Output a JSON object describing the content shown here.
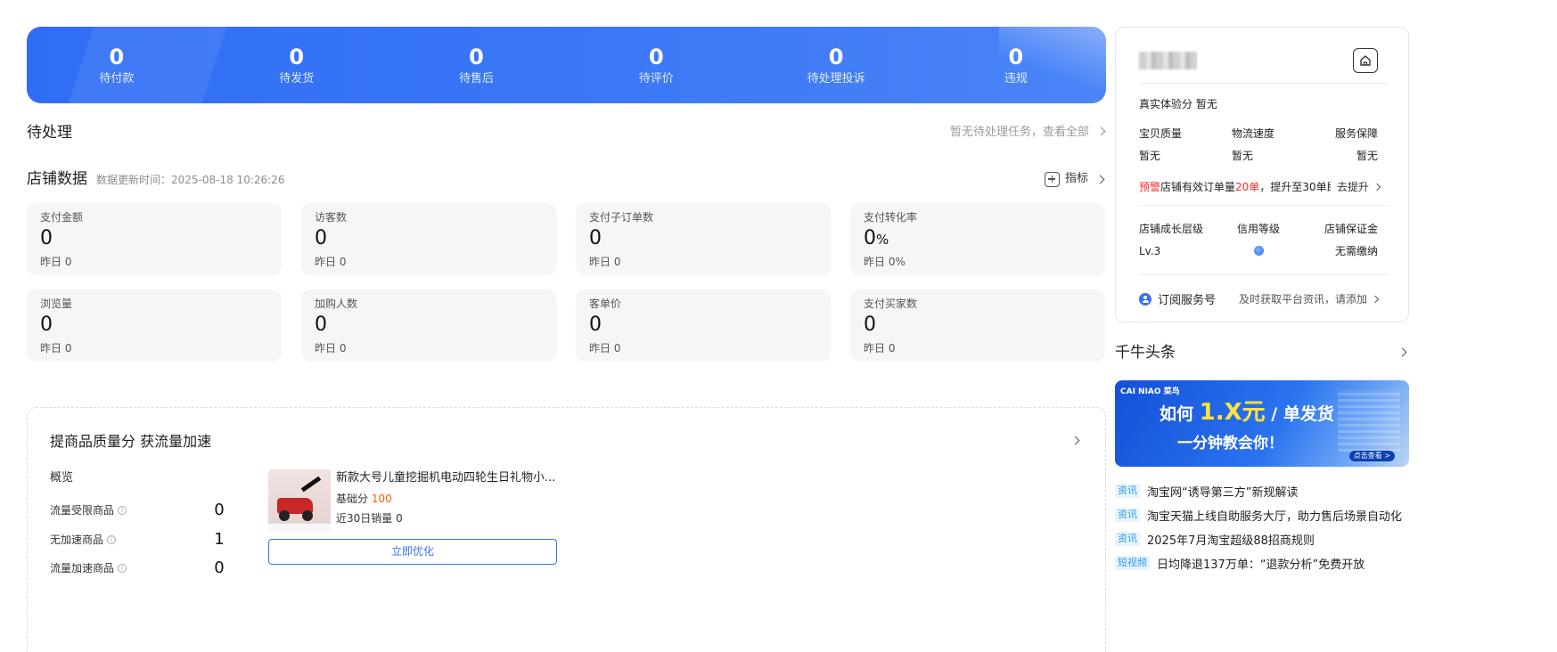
{
  "status_bar": [
    {
      "count": "0",
      "label": "待付款"
    },
    {
      "count": "0",
      "label": "待发货"
    },
    {
      "count": "0",
      "label": "待售后"
    },
    {
      "count": "0",
      "label": "待评价"
    },
    {
      "count": "0",
      "label": "待处理投诉"
    },
    {
      "count": "0",
      "label": "违规"
    }
  ],
  "pending": {
    "title": "待处理",
    "link": "暂无待处理任务，查看全部"
  },
  "store_data": {
    "title": "店铺数据",
    "update_time": "数据更新时间：2025-08-18 10:26:26",
    "metric_button": "指标",
    "cards": [
      {
        "label": "支付金额",
        "value": "0",
        "unit": "",
        "yesterday": "昨日 0"
      },
      {
        "label": "访客数",
        "value": "0",
        "unit": "",
        "yesterday": "昨日 0"
      },
      {
        "label": "支付子订单数",
        "value": "0",
        "unit": "",
        "yesterday": "昨日 0"
      },
      {
        "label": "支付转化率",
        "value": "0",
        "unit": "%",
        "yesterday": "昨日 0%"
      },
      {
        "label": "浏览量",
        "value": "0",
        "unit": "",
        "yesterday": "昨日 0"
      },
      {
        "label": "加购人数",
        "value": "0",
        "unit": "",
        "yesterday": "昨日 0"
      },
      {
        "label": "客单价",
        "value": "0",
        "unit": "",
        "yesterday": "昨日 0"
      },
      {
        "label": "支付买家数",
        "value": "0",
        "unit": "",
        "yesterday": "昨日 0"
      }
    ]
  },
  "quality": {
    "title": "提商品质量分 获流量加速",
    "overview_label": "概览",
    "rows": [
      {
        "label": "流量受限商品",
        "value": "0"
      },
      {
        "label": "无加速商品",
        "value": "1"
      },
      {
        "label": "流量加速商品",
        "value": "0"
      }
    ],
    "product": {
      "name": "新款大号儿童挖掘机电动四轮生日礼物小...",
      "score_label": "基础分",
      "score": "100",
      "sales": "近30日销量 0"
    },
    "optimize_button": "立即优化"
  },
  "shop_card": {
    "experience_score": "真实体验分  暂无",
    "metrics_labels": [
      "宝贝质量",
      "物流速度",
      "服务保障"
    ],
    "metrics_values": [
      "暂无",
      "暂无",
      "暂无"
    ],
    "warning": {
      "tag": "预警",
      "text_before": "店铺有效订单量",
      "highlight": "20单",
      "text_after": "，提升至30单即..."
    },
    "improve_link": "去提升",
    "level_labels": [
      "店铺成长层级",
      "信用等级",
      "店铺保证金"
    ],
    "level_value": "Lv.3",
    "deposit_value": "无需缴纳",
    "subscribe_label": "订阅服务号",
    "subscribe_hint": "及时获取平台资讯，请添加"
  },
  "headlines": {
    "title": "千牛头条",
    "banner": {
      "brand": "CAI NIAO 菜鸟",
      "line1_prefix": "如何",
      "line1_big": "1.X元",
      "line1_suffix": "/ 单发货",
      "line2": "一分钟教会你！",
      "cta": "点击查看 >"
    },
    "items": [
      {
        "tag": "资讯",
        "text": "淘宝网“诱导第三方”新规解读"
      },
      {
        "tag": "资讯",
        "text": "淘宝天猫上线自助服务大厅，助力售后场景自动化"
      },
      {
        "tag": "资讯",
        "text": "2025年7月淘宝超级88招商规则"
      },
      {
        "tag": "短视频",
        "text": "日均降退137万单：“退款分析”免费开放"
      }
    ]
  },
  "colors": {
    "banner_blue": "#3b78f6",
    "accent_blue": "#3a6ff7",
    "warning_red": "#ff2d2d",
    "score_orange": "#ff5a00",
    "success_green": "#2db87a"
  }
}
